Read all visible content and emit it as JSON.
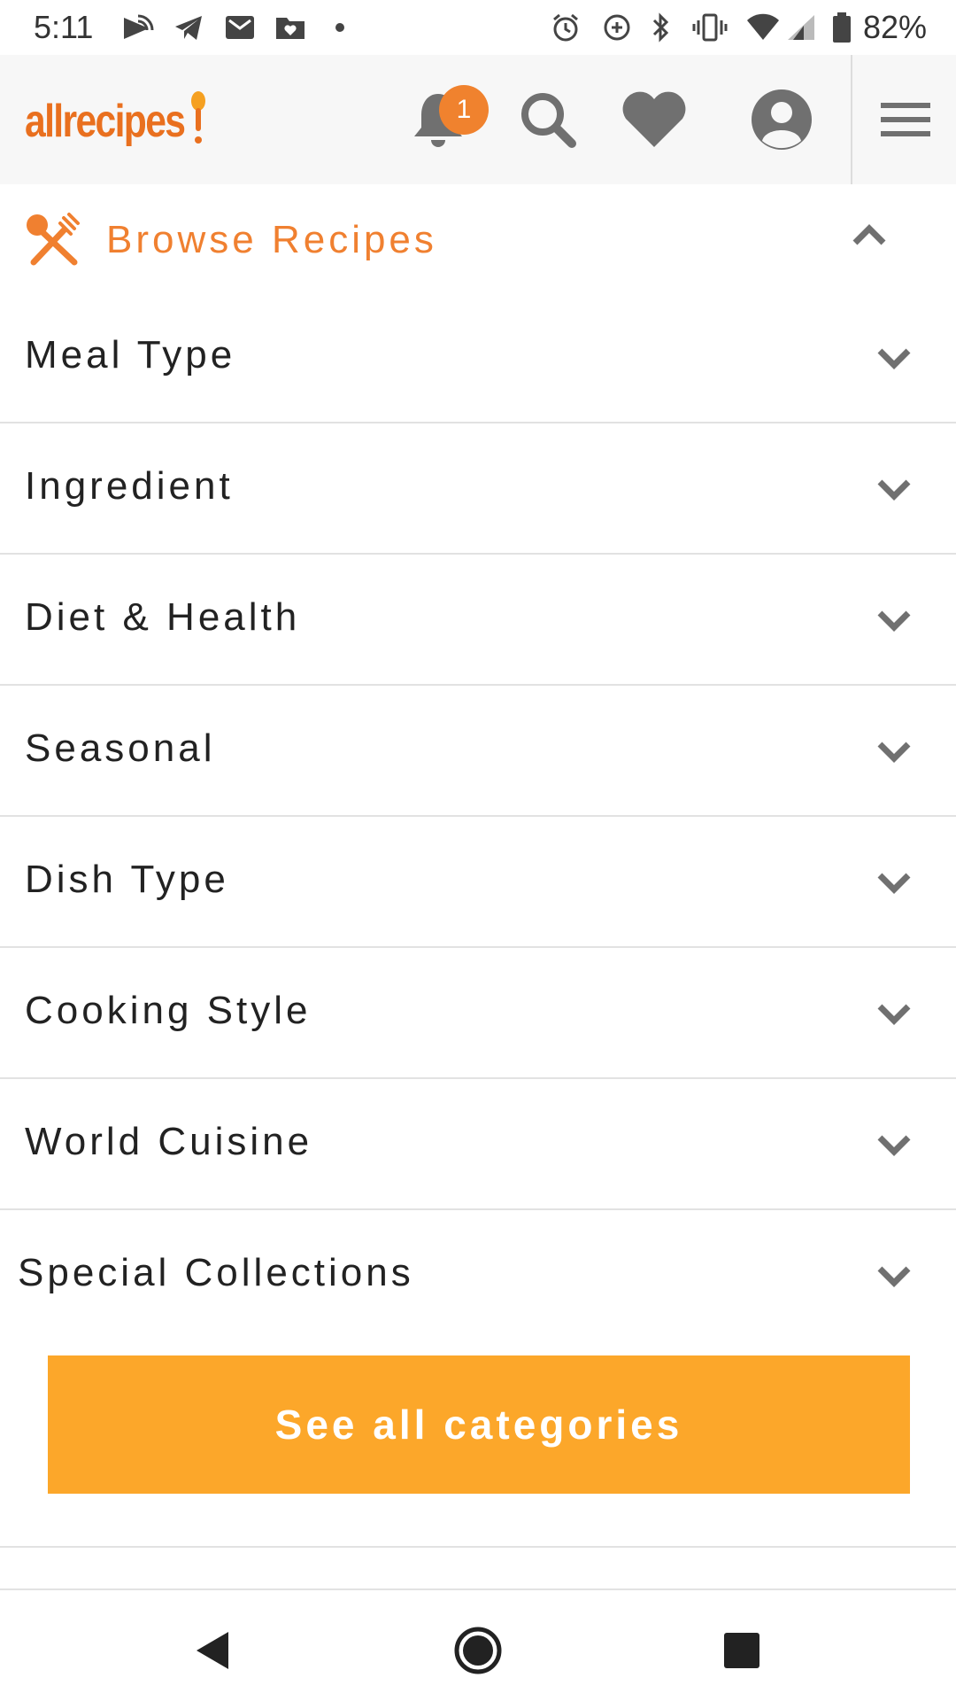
{
  "status_bar": {
    "time": "5:11",
    "battery_percent": "82%"
  },
  "header": {
    "logo_text": "allrecipes",
    "notification_count": "1",
    "icons": [
      "bell-icon",
      "search-icon",
      "heart-icon",
      "account-icon",
      "menu-icon"
    ]
  },
  "browse": {
    "title": "Browse Recipes",
    "icon": "fork-spoon-icon",
    "expanded": true
  },
  "menu_items": [
    {
      "label": "Meal Type"
    },
    {
      "label": "Ingredient"
    },
    {
      "label": "Diet & Health"
    },
    {
      "label": "Seasonal"
    },
    {
      "label": "Dish Type"
    },
    {
      "label": "Cooking Style"
    },
    {
      "label": "World Cuisine"
    },
    {
      "label": "Special Collections"
    }
  ],
  "cta": {
    "label": "See all categories"
  },
  "colors": {
    "brand_orange": "#e9701f",
    "cta_orange": "#fca72a",
    "icon_grey": "#707070"
  }
}
